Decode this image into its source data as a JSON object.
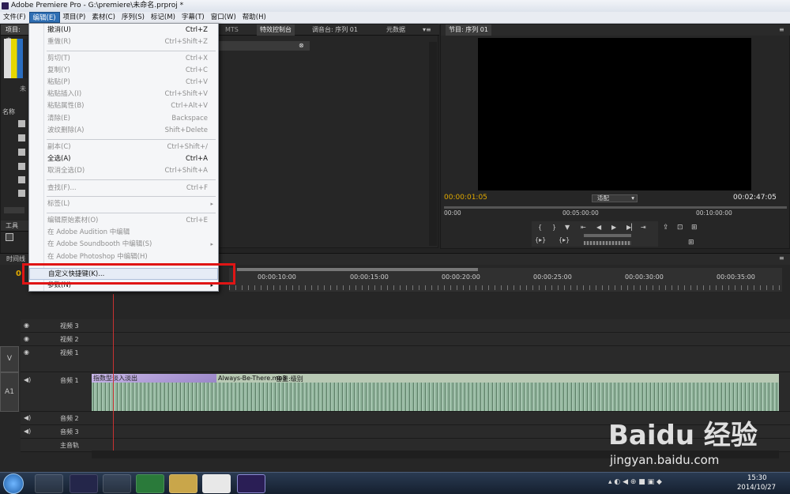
{
  "window": {
    "title": "Adobe Premiere Pro - G:\\premiere\\未命名.prproj *"
  },
  "menubar": {
    "items": [
      "文件(F)",
      "编辑(E)",
      "项目(P)",
      "素材(C)",
      "序列(S)",
      "标记(M)",
      "字幕(T)",
      "窗口(W)",
      "帮助(H)"
    ],
    "active_index": 1
  },
  "edit_menu": {
    "items": [
      {
        "label": "撤消(U)",
        "shortcut": "Ctrl+Z",
        "enabled": true
      },
      {
        "label": "重做(R)",
        "shortcut": "Ctrl+Shift+Z",
        "enabled": false
      },
      {
        "label": "剪切(T)",
        "shortcut": "Ctrl+X",
        "enabled": false
      },
      {
        "label": "复制(Y)",
        "shortcut": "Ctrl+C",
        "enabled": false
      },
      {
        "label": "粘贴(P)",
        "shortcut": "Ctrl+V",
        "enabled": false
      },
      {
        "label": "粘贴插入(I)",
        "shortcut": "Ctrl+Shift+V",
        "enabled": false
      },
      {
        "label": "粘贴属性(B)",
        "shortcut": "Ctrl+Alt+V",
        "enabled": false
      },
      {
        "label": "清除(E)",
        "shortcut": "Backspace",
        "enabled": false
      },
      {
        "label": "波纹删除(A)",
        "shortcut": "Shift+Delete",
        "enabled": false
      },
      {
        "label": "副本(C)",
        "shortcut": "Ctrl+Shift+/",
        "enabled": false
      },
      {
        "label": "全选(A)",
        "shortcut": "Ctrl+A",
        "enabled": true
      },
      {
        "label": "取消全选(D)",
        "shortcut": "Ctrl+Shift+A",
        "enabled": false
      },
      {
        "label": "查找(F)...",
        "shortcut": "Ctrl+F",
        "enabled": false
      },
      {
        "label": "标签(L)",
        "shortcut": "",
        "enabled": false,
        "submenu": true
      },
      {
        "label": "编辑原始素材(O)",
        "shortcut": "Ctrl+E",
        "enabled": false
      },
      {
        "label": "在 Adobe Audition 中编辑",
        "shortcut": "",
        "enabled": false
      },
      {
        "label": "在 Adobe Soundbooth 中编辑(S)",
        "shortcut": "",
        "enabled": false,
        "submenu": true
      },
      {
        "label": "在 Adobe Photoshop 中编辑(H)",
        "shortcut": "",
        "enabled": false
      },
      {
        "label": "自定义快捷键(K)...",
        "shortcut": "",
        "enabled": true
      },
      {
        "label": "参数(N)",
        "shortcut": "",
        "enabled": true,
        "submenu": true
      }
    ]
  },
  "project_panel": {
    "tab": "项目: 未",
    "name_col": "名称",
    "tools_tab": "工具",
    "bin_label": "未"
  },
  "source_panel": {
    "tabs": [
      "特效控制台",
      "调音台: 序列 01",
      "元数据"
    ],
    "hidden_tab": "MTS"
  },
  "program_monitor": {
    "tab": "节目: 序列 01",
    "timecode_current": "00:00:01:05",
    "timecode_duration": "00:02:47:05",
    "fit_label": "适配",
    "ruler": [
      "00:00",
      "00:05:00:00",
      "00:10:00:00"
    ]
  },
  "timeline": {
    "tab": "时间线",
    "timecode": "0",
    "ruler_labels": [
      "00:00:10:00",
      "00:00:15:00",
      "00:00:20:00",
      "00:00:25:00",
      "00:00:30:00",
      "00:00:35:00"
    ],
    "tracks": {
      "v3": "视频 3",
      "v2": "视频 2",
      "v1": "视频 1",
      "a1": "音频 1",
      "a2": "音频 2",
      "a3": "音频 3",
      "master": "主音轨"
    },
    "target_v": "V",
    "target_a": "A1",
    "clip_transition": "指数型淡入淡出",
    "clip_name": "Always-Be-There.mp3",
    "clip_volume": "音量:级别"
  },
  "taskbar": {
    "time": "15:30",
    "date": "2014/10/27"
  },
  "watermark": {
    "brand": "Baidu 经验",
    "url": "jingyan.baidu.com"
  },
  "colors": {
    "accent": "#2f6fb4",
    "timecode": "#e0a900",
    "highlight": "#e01515",
    "wave": "#8fb39a"
  }
}
